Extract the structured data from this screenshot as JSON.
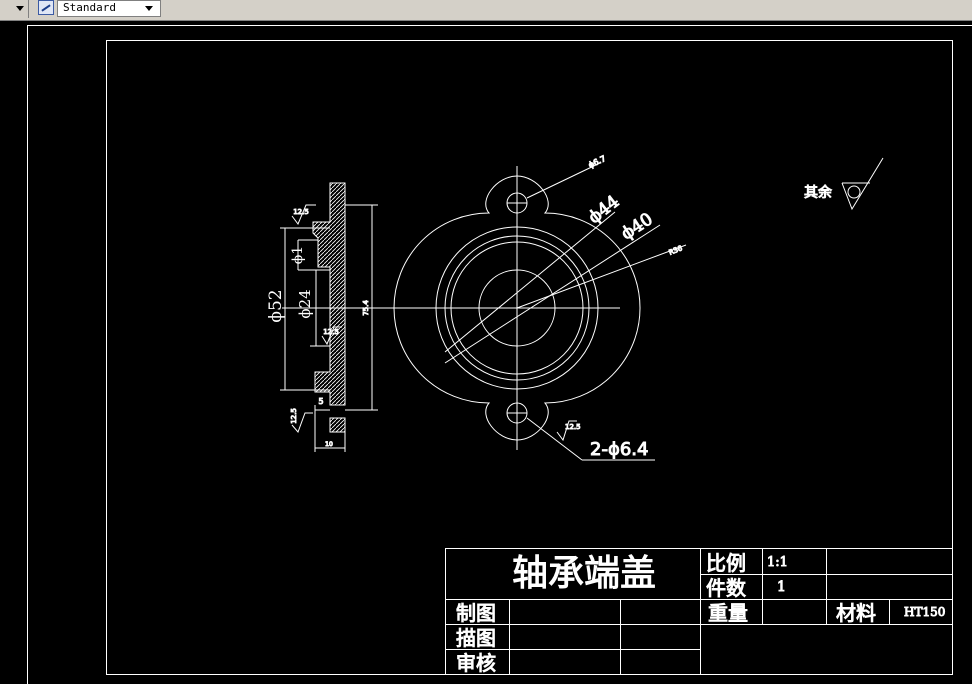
{
  "toolbar": {
    "text_style_icon": "text-style-icon",
    "text_style_value": "Standard"
  },
  "colors": {
    "background": "#000000",
    "lines": "#ffffff",
    "toolbar": "#d4d0c8"
  },
  "drawing": {
    "section_view": {
      "dim_d52": "ϕ52",
      "dim_d24": "ϕ24",
      "dim_d1": "ϕ1",
      "dim_height": "75.4",
      "dim_width": "10",
      "dim_step": "5",
      "roughness_top": "12.5",
      "roughness_mid": "12.5",
      "roughness_bottom": "12.5"
    },
    "front_view": {
      "dim_hole_small": "ϕ6.7",
      "dim_d44": "ϕ44",
      "dim_d40": "ϕ40",
      "dim_r": "R36",
      "dim_holes": "2-ϕ6.4",
      "roughness": "12.5"
    },
    "other_roughness_label": "其余",
    "title_block": {
      "part_name": "轴承端盖",
      "scale_label": "比例",
      "scale_value": "1:1",
      "qty_label": "件数",
      "qty_value": "1",
      "weight_label": "重量",
      "material_label": "材料",
      "material_value": "HT150",
      "drawn_label": "制图",
      "traced_label": "描图",
      "checked_label": "审核"
    }
  }
}
